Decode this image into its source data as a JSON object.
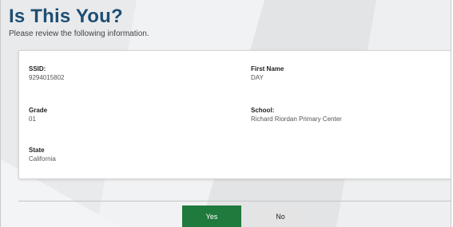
{
  "header": {
    "title": "Is This You?",
    "subtitle": "Please review the following information."
  },
  "student": {
    "ssid": {
      "label": "SSID:",
      "value": "9294015802"
    },
    "first_name": {
      "label": "First Name",
      "value": "DAY"
    },
    "grade": {
      "label": "Grade",
      "value": "01"
    },
    "school": {
      "label": "School:",
      "value": "Richard Riordan Primary Center"
    },
    "state": {
      "label": "State",
      "value": "California"
    }
  },
  "actions": {
    "yes_label": "Yes",
    "no_label": "No"
  },
  "colors": {
    "title": "#1e4e73",
    "yes_button": "#1f7a3e",
    "no_button": "#e4e4e4",
    "background": "#e9eaec"
  }
}
